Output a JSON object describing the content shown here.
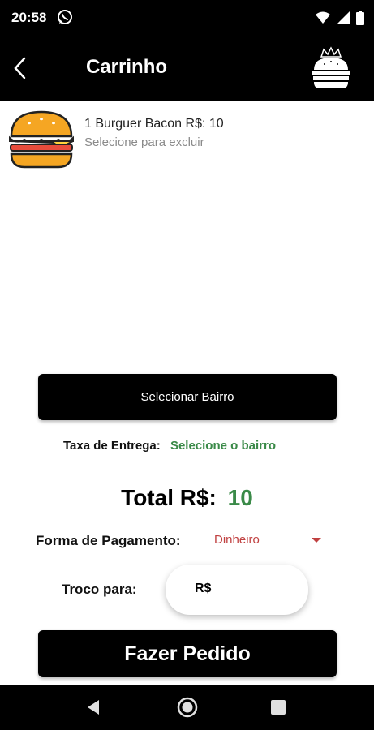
{
  "status_bar": {
    "time": "20:58",
    "left_icons": [
      "whatsapp-icon"
    ],
    "right_icons": [
      "wifi-icon",
      "signal-icon",
      "battery-icon"
    ]
  },
  "app_bar": {
    "title": "Carrinho",
    "back_icon": "arrow-left-icon",
    "logo_icon": "burger-crown-logo"
  },
  "cart": {
    "items": [
      {
        "title": "1 Burguer Bacon R$: 10",
        "subtitle": "Selecione para excluir",
        "image_icon": "burger-icon"
      }
    ]
  },
  "neighborhood": {
    "button_label": "Selecionar Bairro"
  },
  "delivery": {
    "label": "Taxa de Entrega:",
    "value": "Selecione o bairro",
    "value_color": "#3a8a48"
  },
  "total": {
    "label": "Total R$:",
    "value": "10",
    "value_color": "#3a8a48"
  },
  "payment": {
    "label": "Forma de Pagamento:",
    "selected": "Dinheiro",
    "selected_color": "#c04040"
  },
  "change": {
    "label": "Troco para:",
    "prefix": "R$"
  },
  "submit": {
    "label": "Fazer Pedido"
  },
  "nav_bar": {
    "icons": [
      "nav-back-icon",
      "nav-home-icon",
      "nav-recent-icon"
    ]
  },
  "colors": {
    "accent_green": "#3a8a48",
    "accent_red": "#c04040",
    "bar_black": "#000000"
  }
}
